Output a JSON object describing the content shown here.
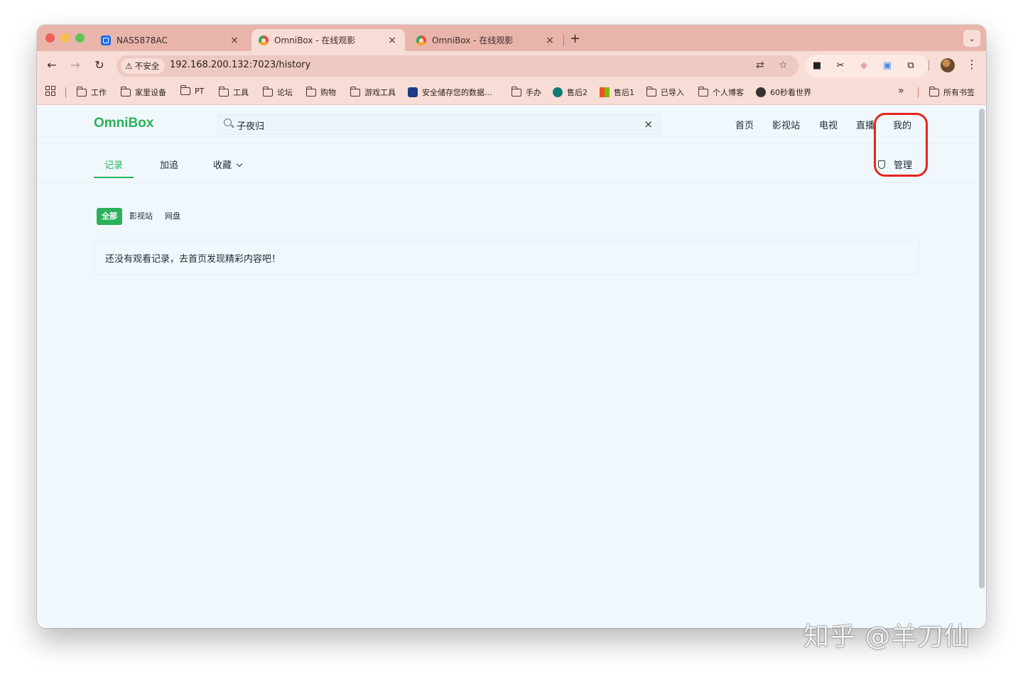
{
  "browser": {
    "tabs": [
      {
        "title": "NAS5878AC",
        "favicon": "nas-icon",
        "active": false
      },
      {
        "title": "OmniBox - 在线观影",
        "favicon": "omnibox-icon",
        "active": true
      },
      {
        "title": "OmniBox - 在线观影",
        "favicon": "omnibox-icon",
        "active": false
      }
    ],
    "close_glyph": "×",
    "new_tab": "+",
    "tab_search": "⌄",
    "security_label": "不安全",
    "url": "192.168.200.132:7023/history",
    "more_bookmarks": "»",
    "menu": "⋮"
  },
  "bookmarks": {
    "items": [
      {
        "label": "工作",
        "icon": "folder-icon"
      },
      {
        "label": "家里设备",
        "icon": "folder-icon"
      },
      {
        "label": "PT",
        "icon": "folder-icon"
      },
      {
        "label": "工具",
        "icon": "folder-icon"
      },
      {
        "label": "论坛",
        "icon": "folder-icon"
      },
      {
        "label": "购物",
        "icon": "folder-icon"
      },
      {
        "label": "游戏工具",
        "icon": "folder-icon"
      },
      {
        "label": "安全储存您的数据...",
        "icon": "storage-icon"
      },
      {
        "label": "手办",
        "icon": "folder-icon"
      },
      {
        "label": "售后2",
        "icon": "sharepoint-icon"
      },
      {
        "label": "售后1",
        "icon": "microsoft-icon"
      },
      {
        "label": "已导入",
        "icon": "folder-icon"
      },
      {
        "label": "个人博客",
        "icon": "folder-icon"
      },
      {
        "label": "60秒看世界",
        "icon": "globe-icon"
      }
    ],
    "all_bookmarks": "所有书签"
  },
  "app": {
    "logo": "OmniBox",
    "search_value": "子夜归",
    "clear_glyph": "×",
    "nav": [
      "首页",
      "影视站",
      "电视",
      "直播",
      "我的"
    ],
    "subtabs": [
      {
        "label": "记录",
        "active": true
      },
      {
        "label": "加追",
        "active": false
      },
      {
        "label": "收藏",
        "active": false
      }
    ],
    "admin_label": "管理",
    "filters": [
      {
        "label": "全部",
        "active": true
      },
      {
        "label": "影视站",
        "active": false
      },
      {
        "label": "网盘",
        "active": false
      }
    ],
    "empty_message": "还没有观看记录，去首页发现精彩内容吧！",
    "accent_color": "#2ab25b",
    "highlight_color": "#e8261b"
  },
  "watermark": "知乎 @羊刀仙"
}
